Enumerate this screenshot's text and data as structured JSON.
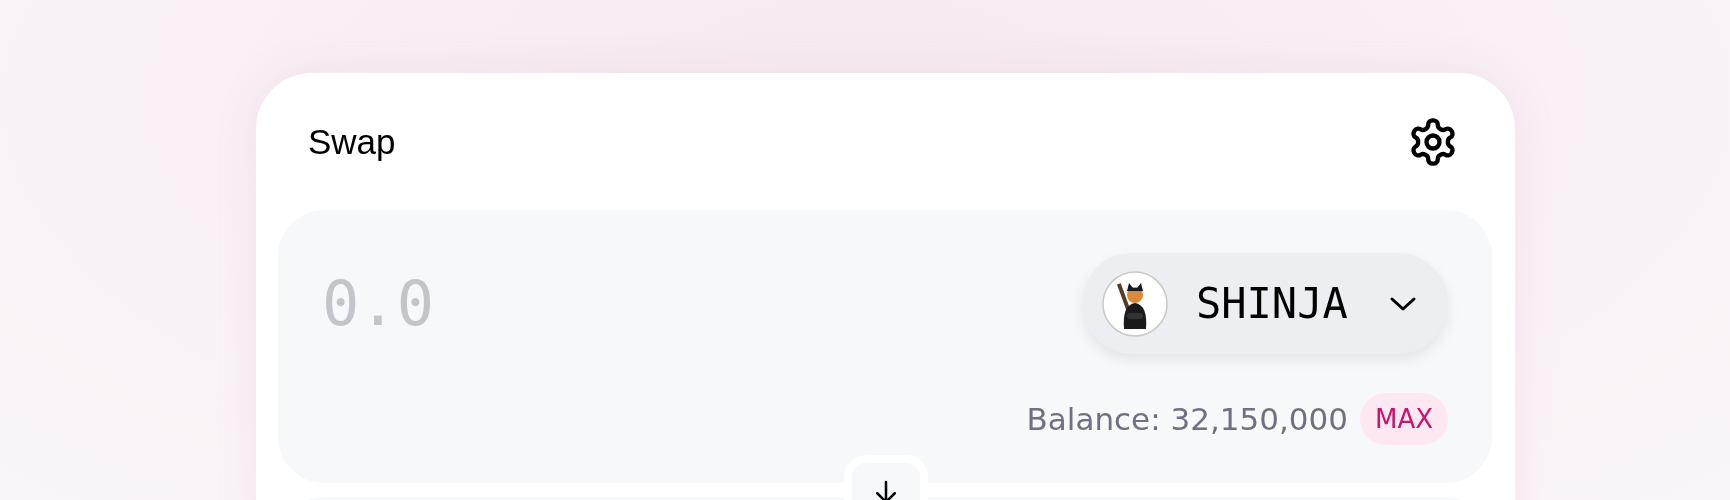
{
  "header": {
    "title": "Swap"
  },
  "input_panel": {
    "amount": {
      "placeholder": "0.0"
    },
    "token": {
      "symbol": "SHINJA"
    },
    "balance": "Balance: 32,150,000",
    "max_button": "MAX"
  }
}
